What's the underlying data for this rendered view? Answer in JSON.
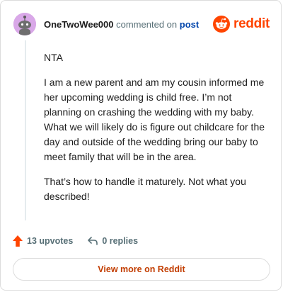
{
  "header": {
    "username": "OneTwoWee000",
    "action_text": "commented on",
    "post_link": "post",
    "brand_name": "reddit"
  },
  "comment": {
    "paragraphs": [
      "NTA",
      "I am a new parent and am my cousin informed me her upcoming wedding is child free. I’m not planning on crashing the wedding with my baby. What we will likely do is figure out childcare for the day and outside of the wedding bring our baby to meet family that will be in the area.",
      "That’s how to handle it maturely. Not what you described!"
    ]
  },
  "actions": {
    "upvotes_label": "13 upvotes",
    "replies_label": "0 replies"
  },
  "footer": {
    "view_more_label": "View more on Reddit"
  },
  "colors": {
    "brand": "#ff4500",
    "link": "#0045ac",
    "muted": "#576f76",
    "avatar_bg": "#d9a8e8"
  },
  "icons": {
    "avatar": "snoo-avatar-icon",
    "brand": "reddit-logo-icon",
    "upvote": "upvote-arrow-icon",
    "reply": "reply-arrow-icon"
  }
}
